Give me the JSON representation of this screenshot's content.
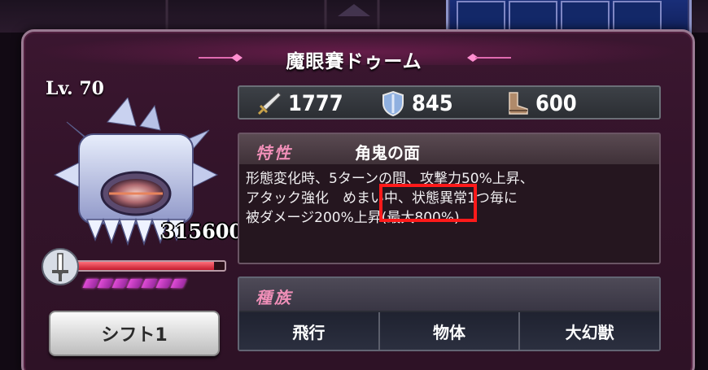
{
  "monster": {
    "name": "魔眼賽ドゥーム",
    "level": "Lv. 70",
    "hp": "315600",
    "hp_fill_fraction": 0.93,
    "charge_pips": 7
  },
  "stats": {
    "attack": "1777",
    "defense": "845",
    "speed": "600"
  },
  "trait": {
    "label": "特性",
    "name": "角鬼の面",
    "text": "形態変化時、5ターンの間、攻撃力50%上昇、\nアタック強化　めまい中、状態異常1つ毎に\n被ダメージ200%上昇(最大800%)"
  },
  "race": {
    "label": "種族",
    "items": [
      "飛行",
      "物体",
      "大幻獣"
    ]
  },
  "shift_button": {
    "label": "シフト1"
  },
  "colors": {
    "frame": "#3b1630",
    "accent_label": "#f08fb8",
    "highlight": "#ff1a1a",
    "hp_fill": "#c41c2e",
    "pip": "#e04bd6"
  }
}
